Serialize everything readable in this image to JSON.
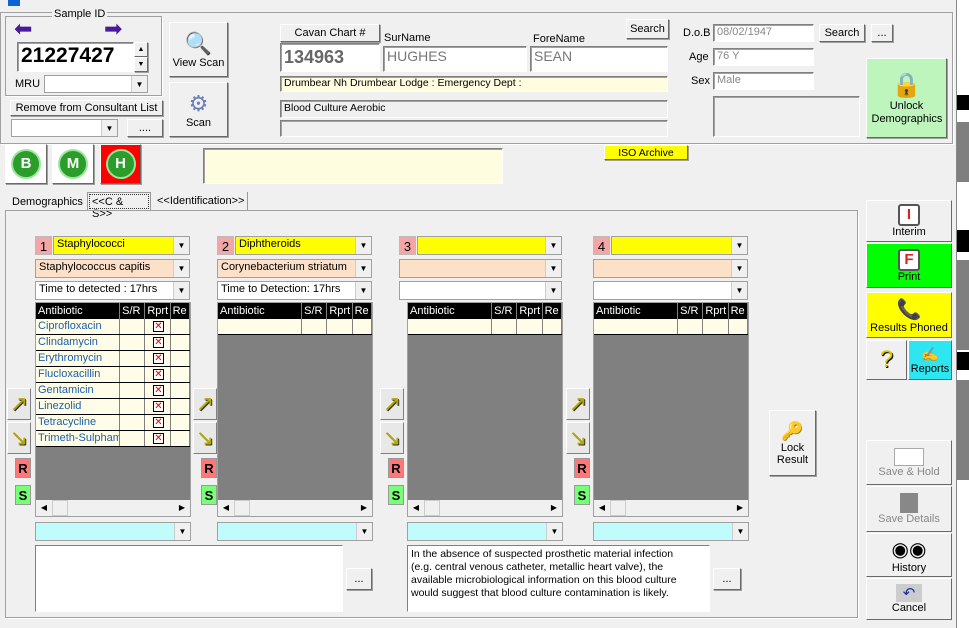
{
  "sample": {
    "group_label": "Sample ID",
    "sample_id": "21227427",
    "mru_label": "MRU",
    "mru_value": "",
    "remove_consultant": "Remove from Consultant List",
    "consultant_value": "",
    "ellipsis": "....",
    "prev_icon": "arrow-left-icon",
    "next_icon": "arrow-right-icon"
  },
  "scan": {
    "view_scan": "View Scan",
    "scan": "Scan"
  },
  "patient": {
    "chart_label": "Cavan Chart #",
    "chart_value": "134963",
    "surname_label": "SurName",
    "surname": "HUGHES",
    "forename_label": "ForeName",
    "forename": "SEAN",
    "search": "Search",
    "address": "Drumbear Nh Drumbear Lodge : Emergency Dept :",
    "specimen": "Blood Culture Aerobic",
    "extra": "",
    "dob_label": "D.o.B",
    "dob": "08/02/1947",
    "dob_search": "Search",
    "dob_more": "...",
    "age_label": "Age",
    "age": "76 Y",
    "sex_label": "Sex",
    "sex": "Male",
    "unlock": "Unlock Demographics"
  },
  "badges": {
    "b": "B",
    "m": "M",
    "h": "H"
  },
  "iso_archive": "ISO Archive",
  "tabs": [
    {
      "label": "Demographics"
    },
    {
      "label": "<<C & S>>"
    },
    {
      "label": "<<Identification>>"
    }
  ],
  "grid_headers": [
    "Antibiotic",
    "S/R",
    "Rprt",
    "Re"
  ],
  "isolates": [
    {
      "num": "1",
      "group": "Staphylococci",
      "organism": "Staphylococcus capitis",
      "time": "Time to detected : 17hrs",
      "antibiotics": [
        "Ciprofloxacin",
        "Clindamycin",
        "Erythromycin",
        "Flucloxacillin",
        "Gentamicin",
        "Linezolid",
        "Tetracycline",
        "Trimeth-Sulphame"
      ]
    },
    {
      "num": "2",
      "group": "Diphtheroids",
      "organism": "Corynebacterium striatum",
      "time": "Time to Detection: 17hrs",
      "antibiotics": []
    },
    {
      "num": "3",
      "group": "",
      "organism": "",
      "time": "",
      "antibiotics": []
    },
    {
      "num": "4",
      "group": "",
      "organism": "",
      "time": "",
      "antibiotics": []
    }
  ],
  "rs": {
    "r": "R",
    "s": "S"
  },
  "comments": {
    "left": "",
    "right": "In the absence of suspected prosthetic material infection (e.g. central venous catheter, metallic heart valve), the available microbiological information on this blood culture would suggest that blood culture contamination is likely.",
    "more": "..."
  },
  "lock_result": "Lock Result",
  "actions": {
    "interim": "Interim",
    "interim_glyph": "I",
    "print": "Print",
    "print_glyph": "F",
    "phoned": "Results Phoned",
    "reports": "Reports",
    "save_hold": "Save & Hold",
    "save_details": "Save Details",
    "history": "History",
    "cancel": "Cancel"
  },
  "colors": {
    "yellow": "#ffff00",
    "peach": "#fde0c8",
    "cyan": "#c0fcfc",
    "green": "#00ff00",
    "light_green": "#bdf5bd"
  }
}
